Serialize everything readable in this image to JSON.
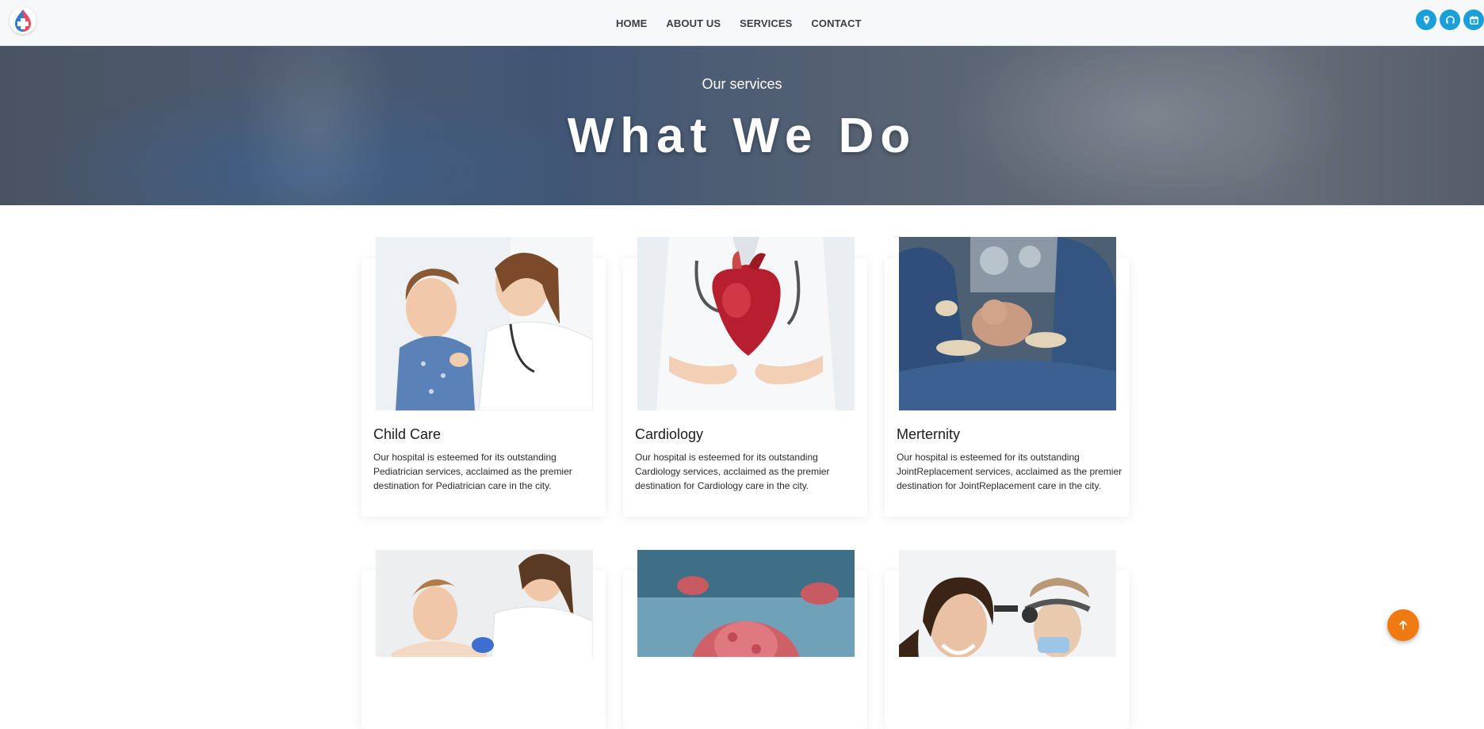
{
  "header": {
    "logo_icon": "medical-cross-logo-icon",
    "nav": [
      {
        "label": "HOME"
      },
      {
        "label": "ABOUT US"
      },
      {
        "label": "SERVICES"
      },
      {
        "label": "CONTACT"
      }
    ],
    "quick_icons": [
      "location-pin-icon",
      "headset-icon",
      "calendar-icon"
    ],
    "accent_color": "#1a9fd8"
  },
  "hero": {
    "subtitle": "Our services",
    "title": "What We Do"
  },
  "services": [
    {
      "title": "Child Care",
      "description": "Our hospital is esteemed for its outstanding Pediatrician services, acclaimed as the premier destination for Pediatrician care in the city.",
      "image": "child-care-photo"
    },
    {
      "title": "Cardiology",
      "description": "Our hospital is esteemed for its outstanding Cardiology services, acclaimed as the premier destination for Cardiology care in the city.",
      "image": "cardiology-photo"
    },
    {
      "title": "Merternity",
      "description": "Our hospital is esteemed for its outstanding JointReplacement services, acclaimed as the premier destination for JointReplacement care in the city.",
      "image": "maternity-photo"
    },
    {
      "title": "",
      "description": "",
      "image": "vaccination-photo"
    },
    {
      "title": "",
      "description": "",
      "image": "oncology-photo"
    },
    {
      "title": "",
      "description": "",
      "image": "ent-photo"
    }
  ],
  "scroll_top": {
    "icon": "arrow-up-icon",
    "color": "#f07a12"
  }
}
